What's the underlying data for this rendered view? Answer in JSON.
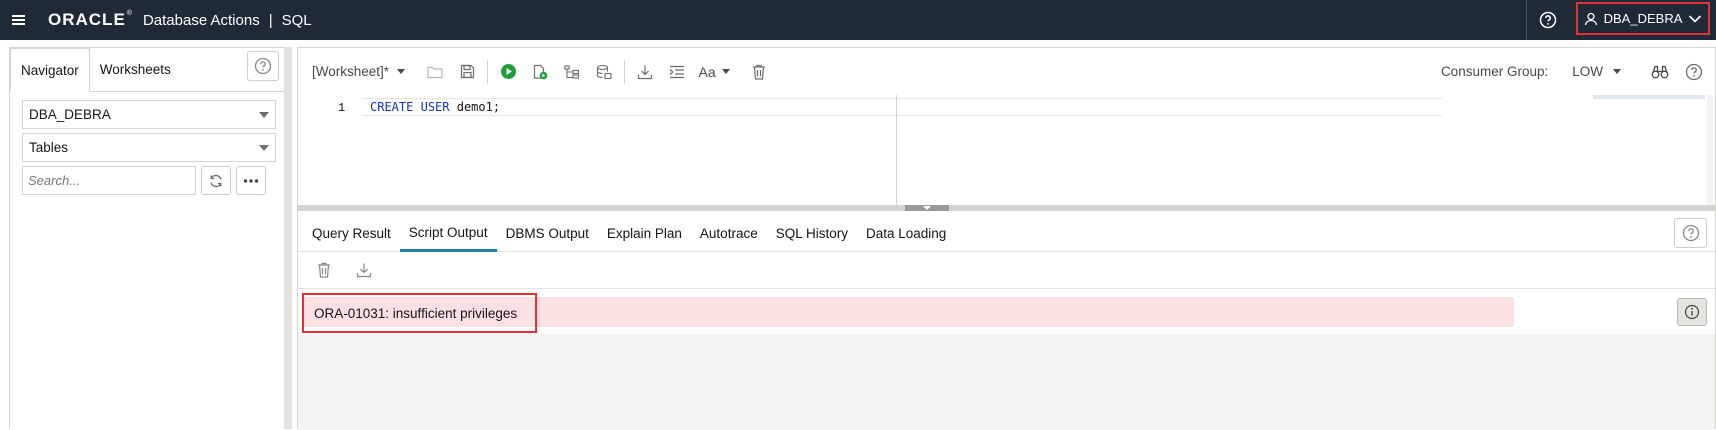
{
  "header": {
    "brand": "ORACLE",
    "app_title": "Database Actions",
    "separator": "|",
    "page_title": "SQL",
    "user": "DBA_DEBRA"
  },
  "navigator": {
    "tabs": [
      {
        "label": "Navigator",
        "active": true
      },
      {
        "label": "Worksheets",
        "active": false
      }
    ],
    "schema_select": "DBA_DEBRA",
    "object_type_select": "Tables",
    "search_placeholder": "Search..."
  },
  "toolbar": {
    "worksheet_label": "[Worksheet]*",
    "font_label": "Aa",
    "consumer_group_label": "Consumer Group:",
    "consumer_group_value": "LOW"
  },
  "editor": {
    "line_number": "1",
    "keyword1": "CREATE",
    "keyword2": "USER",
    "identifier": "demo1;"
  },
  "output": {
    "tabs": [
      {
        "label": "Query Result",
        "active": false
      },
      {
        "label": "Script Output",
        "active": true
      },
      {
        "label": "DBMS Output",
        "active": false
      },
      {
        "label": "Explain Plan",
        "active": false
      },
      {
        "label": "Autotrace",
        "active": false
      },
      {
        "label": "SQL History",
        "active": false
      },
      {
        "label": "Data Loading",
        "active": false
      }
    ],
    "error_message": "ORA-01031: insufficient privileges"
  },
  "colors": {
    "header_bg": "#1f2a36",
    "accent": "#227e9e",
    "error_bg": "#fde0e2",
    "highlight": "#e03232",
    "run_green": "#1f9d38"
  }
}
